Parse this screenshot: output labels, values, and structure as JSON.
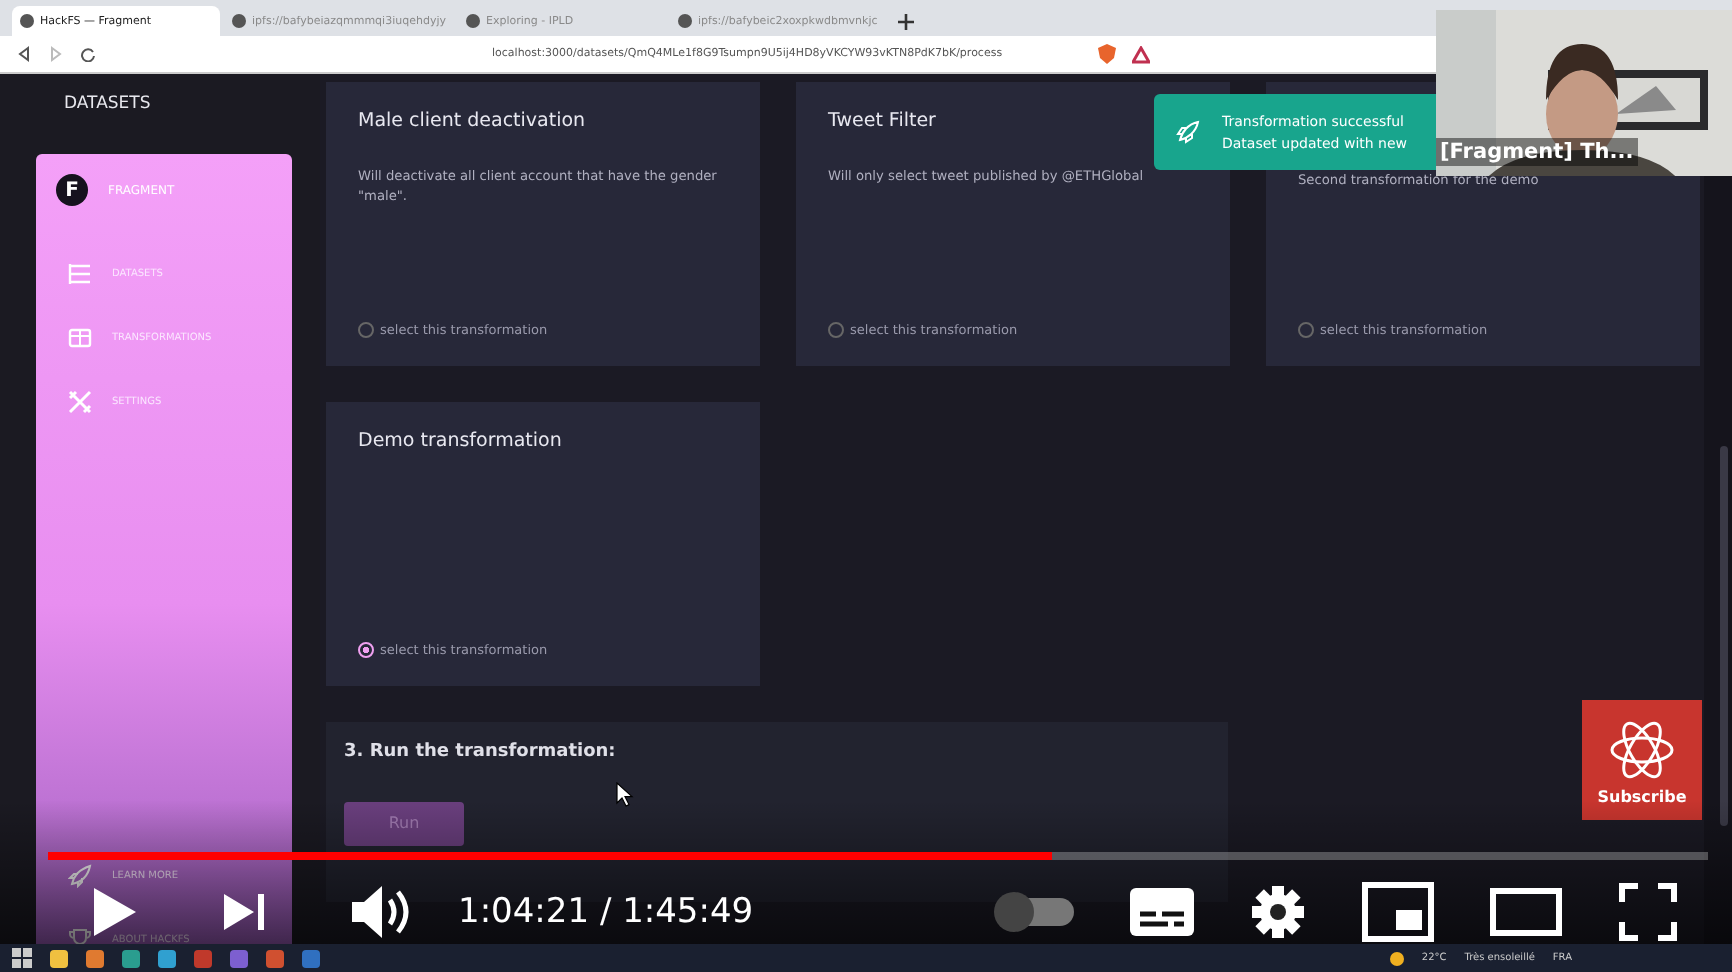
{
  "browser": {
    "tabs": [
      {
        "title": "HackFS — Fragment",
        "selected": true
      },
      {
        "title": "ipfs://bafybeiazqmmmqi3iuqehdyjy",
        "selected": false
      },
      {
        "title": "Exploring - IPLD",
        "selected": false
      },
      {
        "title": "ipfs://bafybeic2xoxpkwdbmvnkjc",
        "selected": false
      }
    ],
    "url": "localhost:3000/datasets/QmQ4MLe1f8G9Tsumpn9U5ij4HD8yVKCYW93vKTN8PdK7bK/process"
  },
  "sidebar": {
    "title": "DATASETS",
    "brand": {
      "logo": "F",
      "name": "FRAGMENT"
    },
    "nav": [
      {
        "label": "DATASETS",
        "kind": "list"
      },
      {
        "label": "TRANSFORMATIONS",
        "kind": "box"
      },
      {
        "label": "SETTINGS",
        "kind": "tools"
      }
    ],
    "footer": [
      {
        "label": "LEARN MORE",
        "kind": "rocket"
      },
      {
        "label": "ABOUT HACKFS",
        "kind": "trophy"
      }
    ]
  },
  "cards": [
    {
      "title": "Male client deactivation",
      "description": "Will deactivate all client account that have the gender \"male\".",
      "option": "select this transformation",
      "selected": false
    },
    {
      "title": "Tweet Filter",
      "description": "Will only select tweet published by @ETHGlobal",
      "option": "select this transformation",
      "selected": false
    },
    {
      "description": "Second transformation for the demo",
      "option": "select this transformation",
      "selected": false
    },
    {
      "title": "Demo transformation",
      "option": "select this transformation",
      "selected": true
    }
  ],
  "run": {
    "heading": "3. Run the transformation:",
    "button": "Run",
    "disabled": true
  },
  "toast": {
    "lines": [
      "Transformation successful",
      "Dataset updated with new"
    ]
  },
  "webcam": {
    "caption": "[Fragment] Th..."
  },
  "subscribe": {
    "label": "Subscribe"
  },
  "player": {
    "level": 0.605,
    "time": "1:04:21 / 1:45:49",
    "autoplay": false
  },
  "taskbar": {
    "temperature": "22°C",
    "weather": "Très ensoleillé",
    "language": "FRA"
  }
}
